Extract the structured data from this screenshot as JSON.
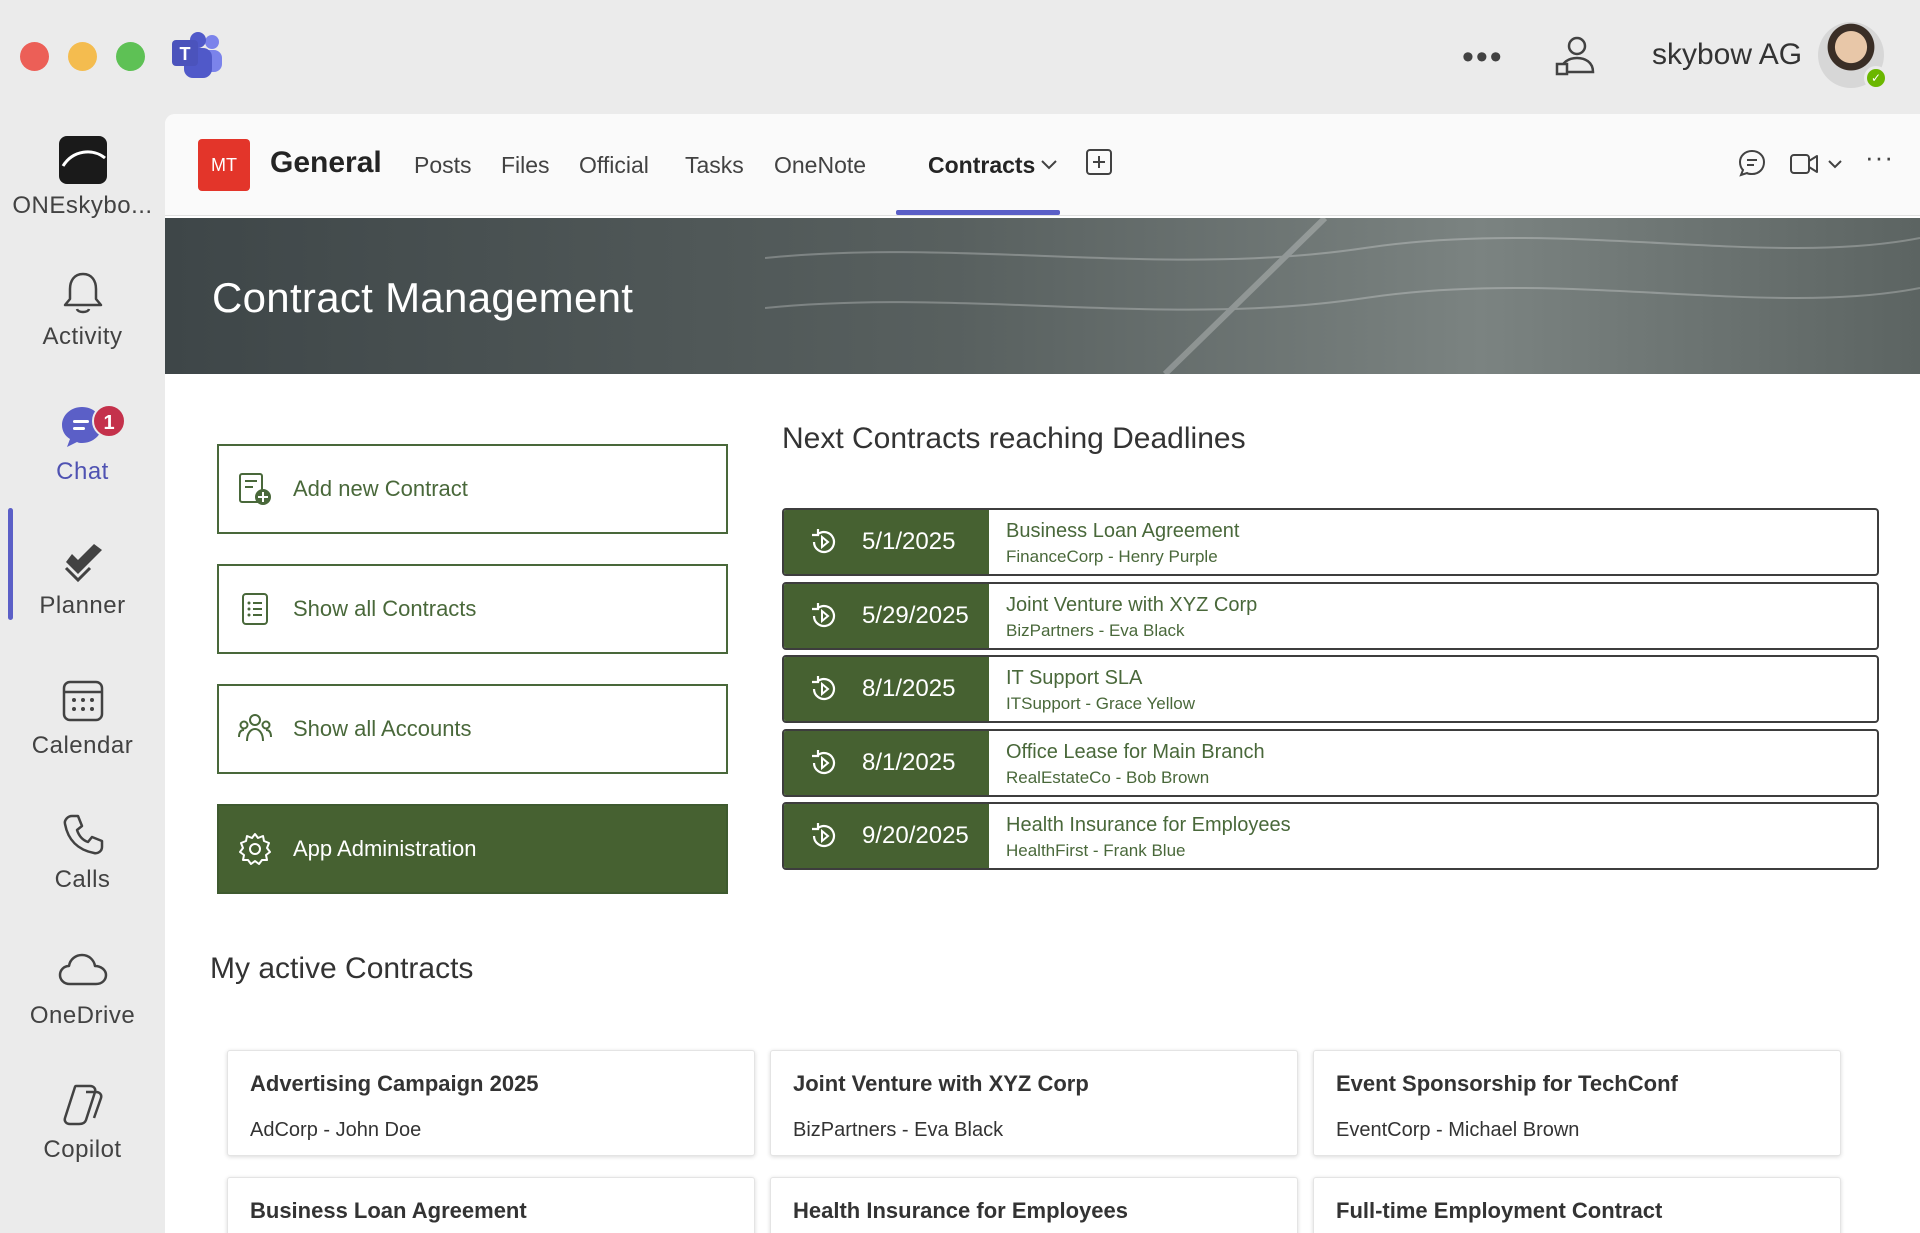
{
  "titlebar": {
    "more_label": "•••",
    "org_name": "skybow AG"
  },
  "rail": {
    "team_name": "ONEskybo...",
    "items": [
      {
        "label": "Activity",
        "icon": "bell-icon"
      },
      {
        "label": "Chat",
        "icon": "chat-icon",
        "badge": "1"
      },
      {
        "label": "Planner",
        "icon": "planner-icon"
      },
      {
        "label": "Calendar",
        "icon": "calendar-icon"
      },
      {
        "label": "Calls",
        "icon": "phone-icon"
      },
      {
        "label": "OneDrive",
        "icon": "cloud-icon"
      },
      {
        "label": "Copilot",
        "icon": "copilot-icon"
      }
    ]
  },
  "channel": {
    "initials": "MT",
    "name": "General",
    "tabs": [
      "Posts",
      "Files",
      "Official",
      "Tasks",
      "OneNote",
      "Contracts"
    ],
    "active_tab": "Contracts",
    "more_label": "···"
  },
  "hero": {
    "title": "Contract Management"
  },
  "actions": [
    {
      "label": "Add new Contract",
      "icon": "add-document-icon"
    },
    {
      "label": "Show all Contracts",
      "icon": "list-icon"
    },
    {
      "label": "Show all Accounts",
      "icon": "people-icon"
    },
    {
      "label": "App Administration",
      "icon": "gear-icon"
    }
  ],
  "deadlines": {
    "title": "Next Contracts reaching Deadlines",
    "items": [
      {
        "date": "5/1/2025",
        "title": "Business Loan Agreement",
        "sub": "FinanceCorp - Henry Purple"
      },
      {
        "date": "5/29/2025",
        "title": "Joint Venture with XYZ Corp",
        "sub": "BizPartners - Eva Black"
      },
      {
        "date": "8/1/2025",
        "title": "IT Support SLA",
        "sub": "ITSupport - Grace Yellow"
      },
      {
        "date": "8/1/2025",
        "title": "Office Lease for Main Branch",
        "sub": "RealEstateCo - Bob Brown"
      },
      {
        "date": "9/20/2025",
        "title": "Health Insurance for Employees",
        "sub": "HealthFirst - Frank Blue"
      }
    ]
  },
  "active": {
    "title": "My active Contracts",
    "cards": [
      {
        "title": "Advertising Campaign 2025",
        "sub": "AdCorp - John Doe"
      },
      {
        "title": "Joint Venture with XYZ Corp",
        "sub": "BizPartners - Eva Black"
      },
      {
        "title": "Event Sponsorship for TechConf",
        "sub": "EventCorp - Michael Brown"
      },
      {
        "title": "Business Loan Agreement",
        "sub": ""
      },
      {
        "title": "Health Insurance for Employees",
        "sub": ""
      },
      {
        "title": "Full-time Employment Contract",
        "sub": ""
      }
    ]
  },
  "colors": {
    "accent_green": "#466131",
    "teams_purple": "#5b5fc7",
    "badge_red": "#c4314b",
    "team_tile_red": "#e3352a"
  }
}
